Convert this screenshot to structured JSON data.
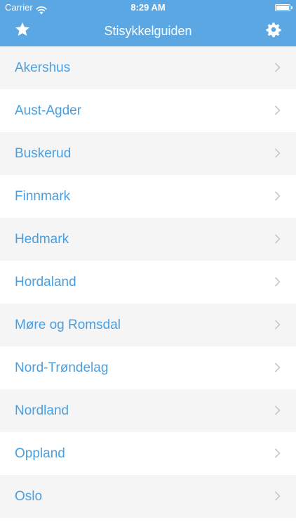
{
  "status_bar": {
    "carrier": "Carrier",
    "time": "8:29 AM",
    "icons": [
      "wifi-icon",
      "battery-icon"
    ]
  },
  "nav_bar": {
    "title": "Stisykkelguiden",
    "left_icon": "star-icon",
    "right_icon": "gear-icon",
    "background": "#5aa7e3"
  },
  "list": {
    "item_icon": "chevron-right-icon",
    "text_color": "#4a9fe0",
    "items": [
      {
        "label": "Akershus"
      },
      {
        "label": "Aust-Agder"
      },
      {
        "label": "Buskerud"
      },
      {
        "label": "Finnmark"
      },
      {
        "label": "Hedmark"
      },
      {
        "label": "Hordaland"
      },
      {
        "label": "Møre og Romsdal"
      },
      {
        "label": "Nord-Trøndelag"
      },
      {
        "label": "Nordland"
      },
      {
        "label": "Oppland"
      },
      {
        "label": "Oslo"
      }
    ]
  }
}
